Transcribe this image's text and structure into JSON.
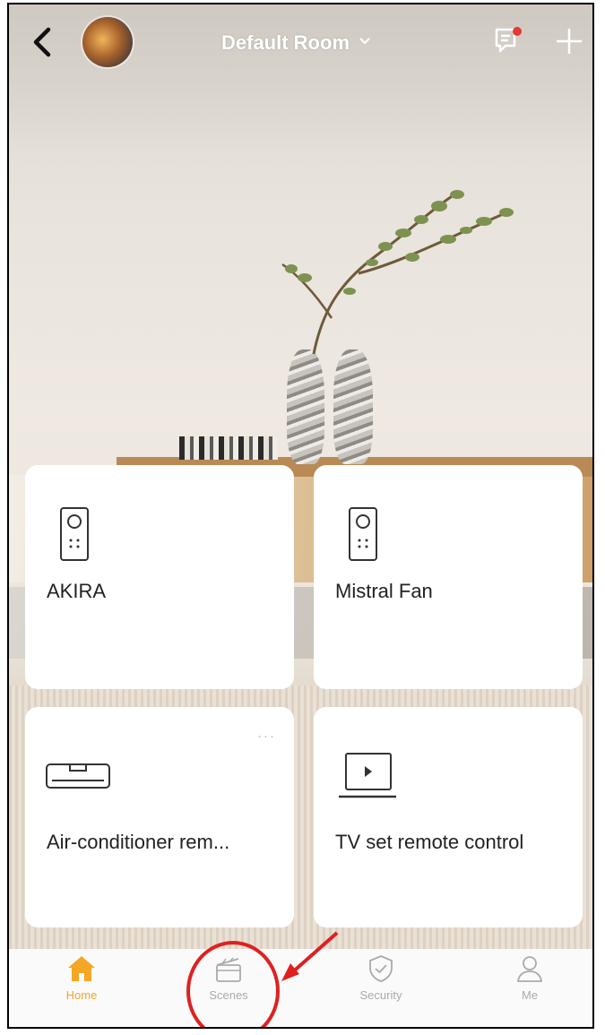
{
  "header": {
    "back_icon": "chevron-left-icon",
    "avatar": "home-avatar",
    "room_title": "Default Room",
    "room_dropdown_icon": "chevron-down-icon",
    "message_icon": "message-icon",
    "add_icon": "plus-icon",
    "notification_color": "#e53935"
  },
  "devices": [
    {
      "label": "AKIRA",
      "icon": "remote-icon"
    },
    {
      "label": "Mistral Fan",
      "icon": "remote-icon"
    },
    {
      "label": "Air-conditioner rem...",
      "icon": "air-conditioner-icon",
      "more": "..."
    },
    {
      "label": "TV set remote control",
      "icon": "tv-icon"
    }
  ],
  "nav": {
    "items": [
      {
        "label": "Home",
        "icon": "home-icon",
        "active": true
      },
      {
        "label": "Scenes",
        "icon": "scenes-icon",
        "active": false
      },
      {
        "label": "Security",
        "icon": "shield-check-icon",
        "active": false
      },
      {
        "label": "Me",
        "icon": "person-icon",
        "active": false
      }
    ],
    "accent": "#f5a623"
  },
  "annotation": {
    "color": "#e02020",
    "target": "Scenes"
  }
}
